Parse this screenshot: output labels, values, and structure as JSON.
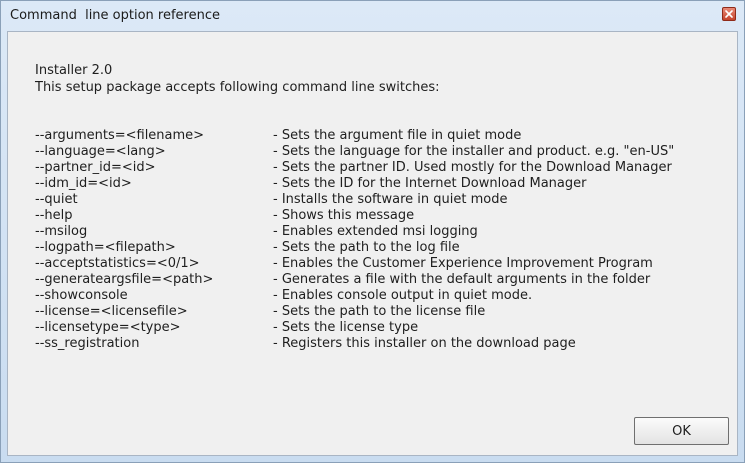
{
  "window": {
    "title": "Command  line option reference",
    "close_icon": "close-icon",
    "accent_color": "#c4432c"
  },
  "intro": {
    "line1": "Installer 2.0",
    "line2": "This setup package accepts following command line switches:"
  },
  "options": [
    {
      "switch": "--arguments=<filename>",
      "description": "- Sets the argument file in quiet mode"
    },
    {
      "switch": "--language=<lang>",
      "description": "- Sets the language for the installer and product. e.g. \"en-US\""
    },
    {
      "switch": "--partner_id=<id>",
      "description": "- Sets the partner ID. Used mostly for the Download Manager"
    },
    {
      "switch": "--idm_id=<id>",
      "description": "- Sets the ID for the Internet Download Manager"
    },
    {
      "switch": "--quiet",
      "description": "- Installs the software in quiet mode"
    },
    {
      "switch": "--help",
      "description": "- Shows this message"
    },
    {
      "switch": "--msilog",
      "description": "- Enables extended msi logging"
    },
    {
      "switch": "--logpath=<filepath>",
      "description": "- Sets the path to the log file"
    },
    {
      "switch": "--acceptstatistics=<0/1>",
      "description": "- Enables the Customer Experience Improvement Program"
    },
    {
      "switch": "--generateargsfile=<path>",
      "description": "- Generates a file with the default arguments in the folder"
    },
    {
      "switch": "--showconsole",
      "description": "- Enables console output in quiet mode."
    },
    {
      "switch": "--license=<licensefile>",
      "description": "- Sets the path to the license file"
    },
    {
      "switch": "--licensetype=<type>",
      "description": "- Sets the license type"
    },
    {
      "switch": "--ss_registration",
      "description": "- Registers this installer on the download page"
    }
  ],
  "buttons": {
    "ok_label": "OK"
  }
}
